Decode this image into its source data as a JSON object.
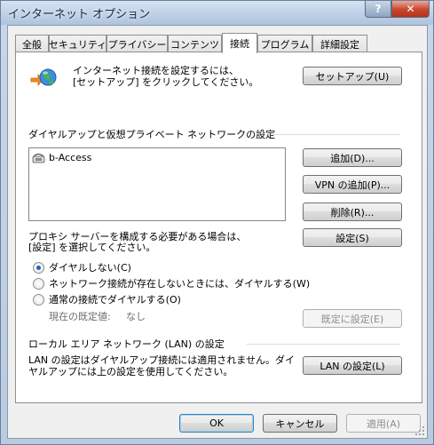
{
  "window": {
    "title": "インターネット オプション",
    "help_label": "?",
    "close_label": "✕"
  },
  "tabs": [
    {
      "label": "全般"
    },
    {
      "label": "セキュリティ"
    },
    {
      "label": "プライバシー"
    },
    {
      "label": "コンテンツ"
    },
    {
      "label": "接続"
    },
    {
      "label": "プログラム"
    },
    {
      "label": "詳細設定"
    }
  ],
  "setup": {
    "text_line1": "インターネット接続を設定するには、",
    "text_line2": "[セットアップ] をクリックしてください。",
    "button": "セットアップ(U)",
    "icon": "globe-connection-icon"
  },
  "dialup": {
    "heading": "ダイヤルアップと仮想プライベート ネットワークの設定",
    "connections": [
      {
        "name": "b-Access",
        "icon": "dialup-connection-icon"
      }
    ],
    "add_button": "追加(D)...",
    "add_vpn_button": "VPN の追加(P)...",
    "remove_button": "削除(R)...",
    "settings_button": "設定(S)",
    "proxy_line1": "プロキシ サーバーを構成する必要がある場合は、",
    "proxy_line2": "[設定] を選択してください。",
    "options": [
      {
        "label": "ダイヤルしない(C)",
        "selected": true
      },
      {
        "label": "ネットワーク接続が存在しないときには、ダイヤルする(W)",
        "selected": false
      },
      {
        "label": "通常の接続でダイヤルする(O)",
        "selected": false
      }
    ],
    "current_default_label": "現在の既定値:",
    "current_default_value": "なし",
    "set_default_button": "既定に設定(E)"
  },
  "lan": {
    "heading": "ローカル エリア ネットワーク (LAN) の設定",
    "text_line1": "LAN の設定はダイヤルアップ接続には適用されません。ダイ",
    "text_line2": "ヤルアップには上の設定を使用してください。",
    "button": "LAN の設定(L)"
  },
  "footer": {
    "ok": "OK",
    "cancel": "キャンセル",
    "apply": "適用(A)"
  },
  "colors": {
    "accent": "#1f5fbf",
    "close_red": "#c8452c"
  }
}
